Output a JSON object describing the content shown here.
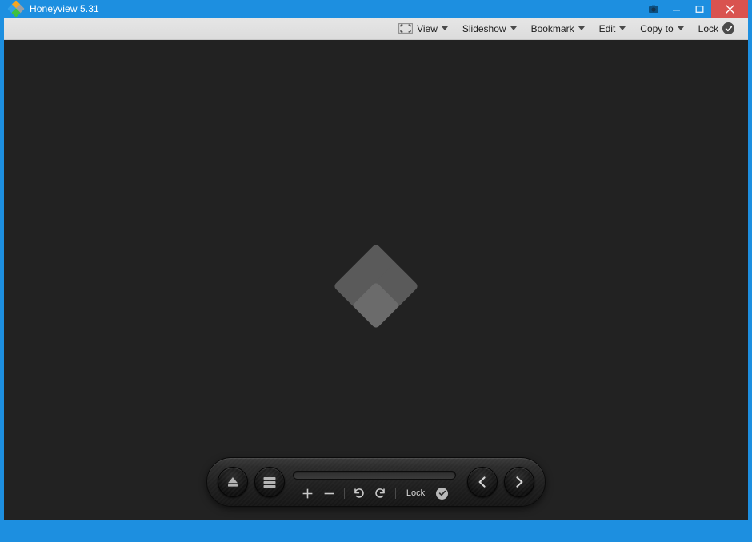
{
  "window": {
    "title": "Honeyview 5.31",
    "app_icon": "honeyview-diamond-logo",
    "controls": [
      {
        "name": "restore-small-icon",
        "glyph": "screenshot-icon"
      },
      {
        "name": "minimize-button",
        "glyph": "minimize-icon"
      },
      {
        "name": "maximize-button",
        "glyph": "maximize-icon"
      },
      {
        "name": "close-button",
        "glyph": "close-icon"
      }
    ],
    "frame_color": "#1d8fe0",
    "close_color": "#d9534f"
  },
  "menubar": {
    "items": [
      {
        "label": "View",
        "icon": "fit-to-window-icon",
        "has_caret": true
      },
      {
        "label": "Slideshow",
        "icon": null,
        "has_caret": true
      },
      {
        "label": "Bookmark",
        "icon": null,
        "has_caret": true
      },
      {
        "label": "Edit",
        "icon": null,
        "has_caret": true
      },
      {
        "label": "Copy to",
        "icon": null,
        "has_caret": true
      },
      {
        "label": "Lock",
        "icon": "check-circle-icon",
        "has_caret": false
      }
    ]
  },
  "canvas": {
    "background_color": "#222222",
    "watermark": "honeyview-diamond-watermark",
    "image_loaded": false
  },
  "floatbar": {
    "open_button": "eject-open-icon",
    "menu_button": "hamburger-menu-icon",
    "seek_value": 0,
    "zoom_in": "+",
    "zoom_out": "−",
    "rotate_left": "rotate-left-icon",
    "rotate_right": "rotate-right-icon",
    "lock_label": "Lock",
    "lock_badge": "check-circle-icon",
    "prev_button": "chevron-left-icon",
    "next_button": "chevron-right-icon"
  }
}
